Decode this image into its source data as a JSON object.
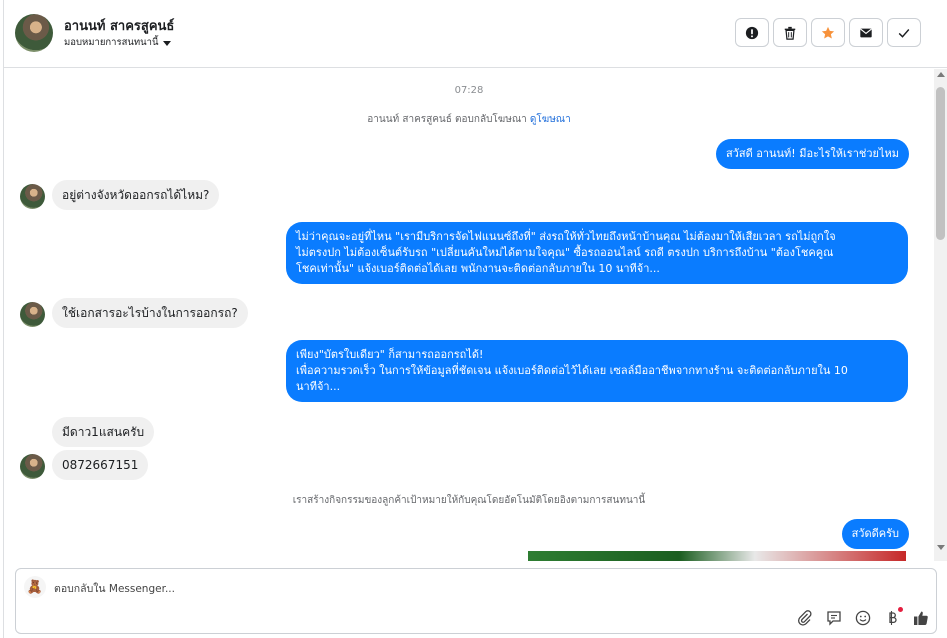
{
  "header": {
    "contact_name": "อานนท์ สาครสูคนธ์",
    "assign_label": "มอบหมายการสนทนานี้",
    "actions": [
      "spam-icon",
      "trash-icon",
      "star-icon",
      "envelope-icon",
      "check-icon"
    ],
    "star_color": "#f7923b"
  },
  "chat": {
    "timestamp": "07:28",
    "reply_note_prefix": "อานนท์ สาครสูคนธ์ ตอบกลับโฆษณา",
    "reply_note_link": "ดูโฆษณา",
    "messages": [
      {
        "dir": "out",
        "text": "สวัสดี อานนท์! มีอะไรให้เราช่วยไหม"
      },
      {
        "dir": "in",
        "text": "อยู่ต่างจังหวัดออกรถได้ไหม?"
      },
      {
        "dir": "out",
        "text": "ไม่ว่าคุณจะอยู่ที่ไหน \"เรามีบริการจัดไฟแนนซ์ถึงที่\"  ส่งรถให้ทั่วไทยถึงหน้าบ้านคุณ ไม่ต้องมาให้เสียเวลา รถไม่ถูกใจ\nไม่ตรงปก ไม่ต้องเซ็นต์รับรถ \"เปลี่ยนคันใหม่ได้ตามใจคุณ\" ซื้อรถออนไลน์ รถดี ตรงปก บริการถึงบ้าน \"ต้องโชคคูณ\nโชคเท่านั้น\" แจ้งเบอร์ติดต่อได้เลย พนักงานจะติดต่อกลับภายใน 10 นาทีจ้า..."
      },
      {
        "dir": "in",
        "text": "ใช้เอกสารอะไรบ้างในการออกรถ?"
      },
      {
        "dir": "out",
        "text": "เพียง\"บัตรใบเดียว\" ก็สามารถออกรถได้!\nเพื่อความรวดเร็ว ในการให้ข้อมูลที่ชัดเจน แจ้งเบอร์ติดต่อไว้ได้เลย เซลล์มืออาชีพจากทางร้าน จะติดต่อกลับภายใน 10\nนาทีจ้า..."
      },
      {
        "dir": "in",
        "text": "มีดาว1แสนครับ"
      },
      {
        "dir": "in",
        "text": "0872667151"
      },
      {
        "dir": "out",
        "text": "สวัดดีครับ"
      }
    ],
    "auto_note": "เราสร้างกิจกรรมของลูกค้าเป้าหมายให้กับคุณโดยอัตโนมัติโดยอิงตามการสนทนานี้",
    "bubble_color": "#0a7cff"
  },
  "composer": {
    "placeholder": "ตอบกลับใน Messenger...",
    "tools": [
      "paperclip-icon",
      "saved-reply-icon",
      "emoji-icon",
      "currency-icon",
      "thumbs-up-icon"
    ],
    "avatar_icon": "teddy-bear-icon"
  }
}
